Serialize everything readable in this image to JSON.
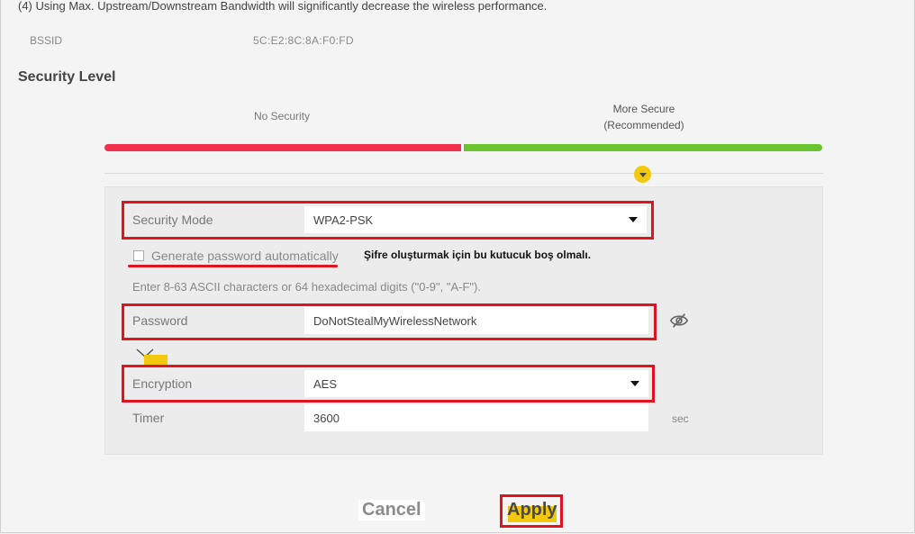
{
  "notes": {
    "bandwidth_warning": "(4) Using Max. Upstream/Downstream Bandwidth will significantly decrease the wireless performance."
  },
  "bssid": {
    "label": "BSSID",
    "value": "5C:E2:8C:8A:F0:FD"
  },
  "security_level": {
    "title": "Security Level",
    "no_security": "No Security",
    "more_secure_line1": "More Secure",
    "more_secure_line2": "(Recommended)",
    "level": 1.0
  },
  "form": {
    "security_mode": {
      "label": "Security Mode",
      "value": "WPA2-PSK"
    },
    "generate_password": {
      "label": "Generate password automatically",
      "checked": false
    },
    "annotation": "Şifre oluşturmak için bu kutucuk boş olmalı.",
    "hint": "Enter 8-63 ASCII characters or 64 hexadecimal digits (\"0-9\", \"A-F\").",
    "password": {
      "label": "Password",
      "value": "DoNotStealMyWirelessNetwork"
    },
    "encryption": {
      "label": "Encryption",
      "value": "AES"
    },
    "timer": {
      "label": "Timer",
      "value": "3600",
      "unit": "sec"
    }
  },
  "buttons": {
    "cancel": "Cancel",
    "apply": "Apply"
  },
  "icons": {
    "level_pointer": "chevron-down-icon",
    "password_visibility": "eye-slash-icon",
    "dropdown": "caret-down-icon"
  },
  "colors": {
    "red": "#f0304c",
    "green": "#6cc431",
    "highlight": "#e0141e",
    "accent": "#f3c90f"
  }
}
